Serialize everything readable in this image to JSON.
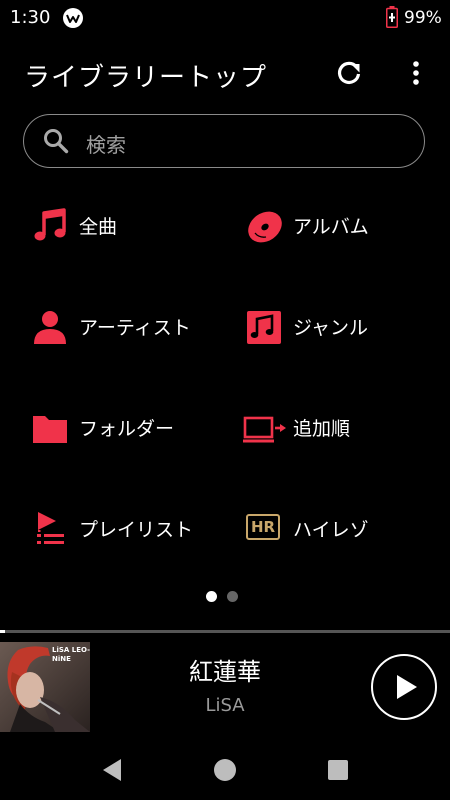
{
  "status": {
    "time": "1:30",
    "battery": "99%"
  },
  "header": {
    "title": "ライブラリートップ"
  },
  "search": {
    "placeholder": "検索"
  },
  "menu": [
    {
      "label": "全曲",
      "icon": "music-note-icon"
    },
    {
      "label": "アルバム",
      "icon": "album-disc-icon"
    },
    {
      "label": "アーティスト",
      "icon": "artist-person-icon"
    },
    {
      "label": "ジャンル",
      "icon": "genre-icon"
    },
    {
      "label": "フォルダー",
      "icon": "folder-icon"
    },
    {
      "label": "追加順",
      "icon": "recently-added-icon"
    },
    {
      "label": "プレイリスト",
      "icon": "playlist-icon"
    },
    {
      "label": "ハイレゾ",
      "icon": "hi-res-icon",
      "badge": "HR"
    }
  ],
  "pagination": {
    "pages": 2,
    "current": 1
  },
  "now_playing": {
    "title": "紅蓮華",
    "artist": "LiSA",
    "album_art_text": "LiSA LEO-NiNE",
    "progress": 0.01
  },
  "colors": {
    "accent": "#f0334a",
    "background": "#000000",
    "hi_res_gold": "#c9a76a"
  }
}
